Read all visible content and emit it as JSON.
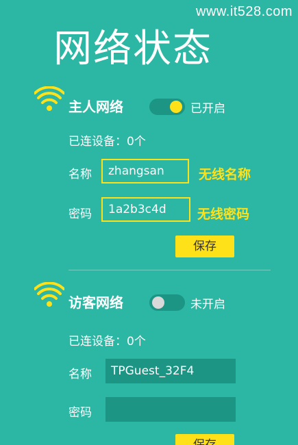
{
  "watermark": "www.it528.com",
  "page_title": "网络状态",
  "main_network": {
    "title": "主人网络",
    "toggle_state": "on",
    "toggle_label": "已开启",
    "devices": "已连设备：0个",
    "name_label": "名称",
    "name_value": "zhangsan",
    "name_annotation": "无线名称",
    "password_label": "密码",
    "password_value": "1a2b3c4d",
    "password_annotation": "无线密码",
    "save_label": "保存"
  },
  "guest_network": {
    "title": "访客网络",
    "toggle_state": "off",
    "toggle_label": "未开启",
    "devices": "已连设备：0个",
    "name_label": "名称",
    "name_value": "TPGuest_32F4",
    "password_label": "密码",
    "password_value": "",
    "save_label": "保存"
  },
  "colors": {
    "background": "#2bb7a3",
    "accent": "#ffe11a",
    "input_bg": "#1c9585"
  },
  "icons": [
    "wifi-icon"
  ]
}
